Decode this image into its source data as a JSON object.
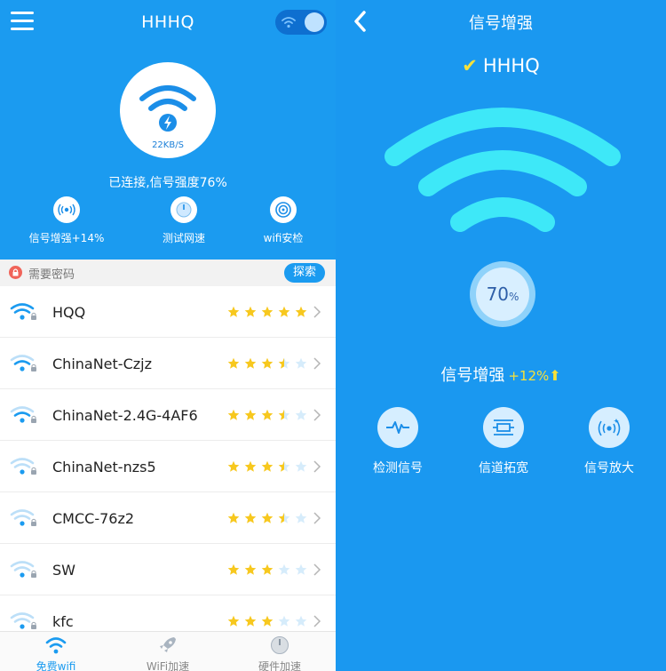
{
  "left": {
    "title": "HHHQ",
    "speed": "22KB/S",
    "status": "已连接,信号强度76%",
    "features": [
      {
        "label": "信号增强+14%"
      },
      {
        "label": "测试网速"
      },
      {
        "label": "wifi安检"
      }
    ],
    "list_header": "需要密码",
    "explore_label": "探索",
    "networks": [
      {
        "name": "HQQ",
        "rating": 5,
        "strength": 3
      },
      {
        "name": "ChinaNet-Czjz",
        "rating": 3.5,
        "strength": 2
      },
      {
        "name": "ChinaNet-2.4G-4AF6",
        "rating": 3.5,
        "strength": 2
      },
      {
        "name": "ChinaNet-nzs5",
        "rating": 3.5,
        "strength": 1
      },
      {
        "name": "CMCC-76z2",
        "rating": 3.5,
        "strength": 1
      },
      {
        "name": "SW",
        "rating": 3,
        "strength": 1
      },
      {
        "name": "kfc",
        "rating": 3,
        "strength": 1
      }
    ],
    "tabs": [
      {
        "label": "免费wifi",
        "active": true
      },
      {
        "label": "WiFi加速",
        "active": false
      },
      {
        "label": "硬件加速",
        "active": false
      }
    ]
  },
  "right": {
    "title": "信号增强",
    "ssid": "HHHQ",
    "check": "✔",
    "percent": "70",
    "percent_unit": "%",
    "boost_label": "信号增强",
    "boost_value": "+12%",
    "boost_arrow": "⬆",
    "features": [
      {
        "label": "检测信号"
      },
      {
        "label": "信道拓宽"
      },
      {
        "label": "信号放大"
      }
    ]
  },
  "colors": {
    "background": "#1b9bf0",
    "accent_cyan": "#3ee8f8",
    "star": "#f7c81e",
    "star_empty": "#d6ecfb",
    "highlight_yellow": "#f6e13a"
  }
}
